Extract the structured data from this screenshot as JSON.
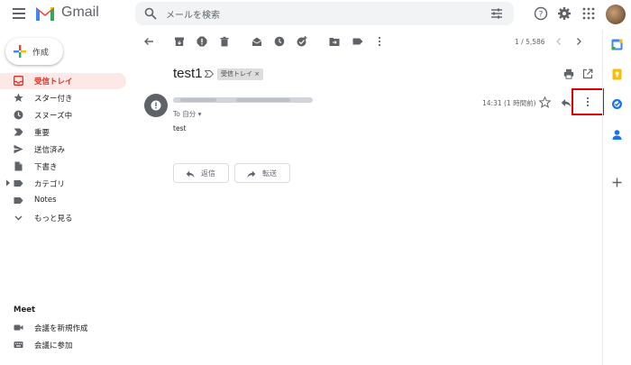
{
  "header": {
    "app_name": "Gmail",
    "search_placeholder": "メールを検索"
  },
  "sidebar": {
    "compose_label": "作成",
    "items": [
      {
        "label": "受信トレイ",
        "icon": "inbox-icon",
        "active": true
      },
      {
        "label": "スター付き",
        "icon": "star-icon"
      },
      {
        "label": "スヌーズ中",
        "icon": "clock-icon"
      },
      {
        "label": "重要",
        "icon": "important-icon"
      },
      {
        "label": "送信済み",
        "icon": "send-icon"
      },
      {
        "label": "下書き",
        "icon": "draft-icon"
      },
      {
        "label": "カテゴリ",
        "icon": "label-icon"
      },
      {
        "label": "Notes",
        "icon": "label-icon"
      },
      {
        "label": "もっと見る",
        "icon": "chevron-down-icon"
      }
    ]
  },
  "meet": {
    "title": "Meet",
    "items": [
      {
        "label": "会議を新規作成",
        "icon": "video-icon"
      },
      {
        "label": "会議に参加",
        "icon": "keyboard-icon"
      }
    ]
  },
  "toolbar": {
    "page_count": "1 / 5,586"
  },
  "message": {
    "subject": "test1",
    "label_chip": "受信トレイ ×",
    "to_line": "To 自分 ▾",
    "timestamp": "14:31 (1 時間前)",
    "body": "test",
    "reply_label": "返信",
    "forward_label": "転送"
  },
  "colors": {
    "accent_red": "#d93025",
    "highlight_box": "#e00000",
    "active_bg": "#fce8e6"
  }
}
